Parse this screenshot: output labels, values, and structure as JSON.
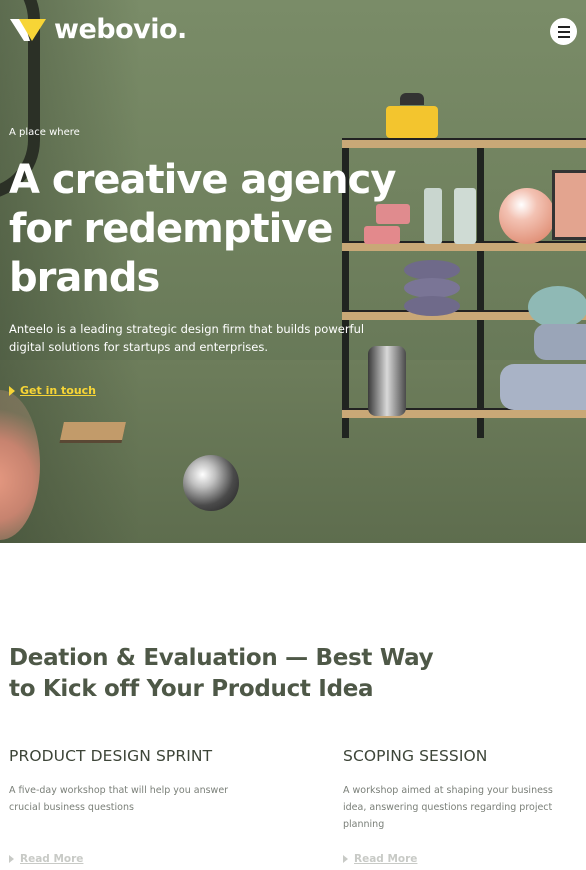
{
  "brand": {
    "name": "webovio.",
    "accent": "#f7d536"
  },
  "header": {
    "menu_icon": "hamburger-icon"
  },
  "hero": {
    "eyebrow": "A place where",
    "title_line1": "A creative agency",
    "title_line2": "for redemptive",
    "title_line3": "brands",
    "description": "Anteelo is a leading strategic design firm that builds powerful digital solutions for startups and enterprises.",
    "cta_label": "Get in touch"
  },
  "section": {
    "title": "Deation & Evaluation — Best Way to Kick off Your Product Idea",
    "cards": [
      {
        "title": "PRODUCT DESIGN SPRINT",
        "description": "A five-day workshop that will help you answer crucial business questions",
        "link": "Read More"
      },
      {
        "title": "SCOPING SESSION",
        "description": "A workshop aimed at shaping your business idea, answering questions regarding project planning",
        "link": "Read More"
      }
    ]
  }
}
